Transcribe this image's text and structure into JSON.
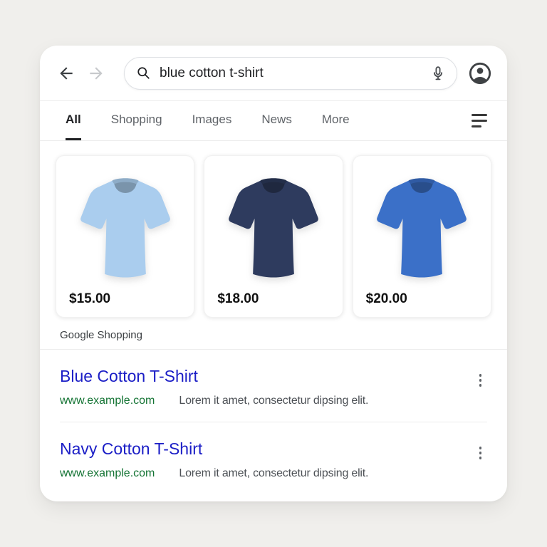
{
  "search_bar": {
    "query": "blue cotton t-shirt"
  },
  "tabs": {
    "items": [
      {
        "label": "All",
        "active": true
      },
      {
        "label": "Shopping",
        "active": false
      },
      {
        "label": "Images",
        "active": false
      },
      {
        "label": "News",
        "active": false
      },
      {
        "label": "More",
        "active": false
      }
    ]
  },
  "shopping": {
    "source_label": "Google Shopping",
    "products": [
      {
        "description": "light blue t-shirt",
        "price": "$15.00",
        "shirt_color": "#aacdee"
      },
      {
        "description": "navy t-shirt",
        "price": "$18.00",
        "shirt_color": "#2e3b5e"
      },
      {
        "description": "blue t-shirt",
        "price": "$20.00",
        "shirt_color": "#3b70c8"
      }
    ]
  },
  "results": [
    {
      "title": "Blue Cotton T-Shirt",
      "url": "www.example.com",
      "snippet": "Lorem it amet, consectetur dipsing elit."
    },
    {
      "title": "Navy Cotton T-Shirt",
      "url": "www.example.com",
      "snippet": "Lorem it amet, consectetur dipsing elit."
    }
  ],
  "colors": {
    "page_background": "#f0efec",
    "link_blue": "#1b1ec6",
    "url_green": "#137333",
    "snippet_gray": "#4d5156",
    "price_black": "#111111"
  },
  "icons": {
    "back": "arrow-left",
    "forward": "arrow-right",
    "search": "magnifier",
    "voice": "microphone",
    "account": "person-in-circle",
    "filter": "three-lines",
    "result_menu": "vertical-ellipsis"
  }
}
